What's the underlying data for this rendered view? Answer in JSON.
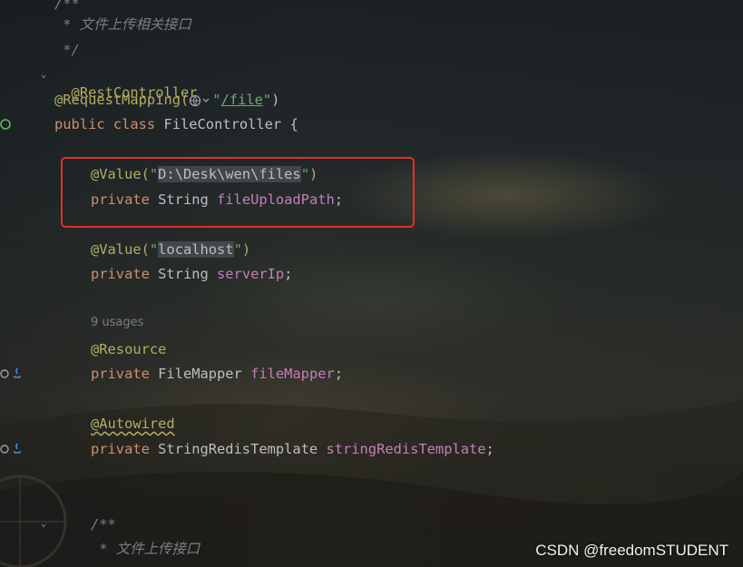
{
  "editor": {
    "lines": {
      "doc_open": "/**",
      "doc_desc": " * 文件上传相关接口",
      "doc_close": " */",
      "rest_controller": "@RestController",
      "request_mapping_ann": "@RequestMapping(",
      "request_mapping_q1": "\"",
      "request_mapping_path": "/file",
      "request_mapping_q2": "\"",
      "request_mapping_close": ")",
      "class_kw": "public class ",
      "class_name": "FileController {",
      "value1_ann": "@Value(",
      "value1_q1": "\"",
      "value1_val": "D:\\Desk\\wen\\files",
      "value1_q2": "\"",
      "value1_close": ")",
      "field1_kw": "private ",
      "field1_type": "String ",
      "field1_name": "fileUploadPath",
      "field1_semi": ";",
      "value2_ann": "@Value(",
      "value2_q1": "\"",
      "value2_val": "localhost",
      "value2_q2": "\"",
      "value2_close": ")",
      "field2_kw": "private ",
      "field2_type": "String ",
      "field2_name": "serverIp",
      "field2_semi": ";",
      "usages": "9 usages",
      "resource_ann": "@Resource",
      "field3_kw": "private ",
      "field3_type": "FileMapper ",
      "field3_name": "fileMapper",
      "field3_semi": ";",
      "autowired_ann": "@Autowired",
      "field4_kw": "private ",
      "field4_type": "StringRedisTemplate ",
      "field4_name": "stringRedisTemplate",
      "field4_semi": ";",
      "doc2_open": "/**",
      "doc2_desc": " * 文件上传接口"
    }
  },
  "watermark": "CSDN @freedomSTUDENT",
  "colors": {
    "annotation": "#b3ae60",
    "keyword": "#cf8e6d",
    "string": "#6aab73",
    "field": "#c77dbb",
    "comment": "#7a7e85",
    "highlight_box": "#e0302a"
  }
}
